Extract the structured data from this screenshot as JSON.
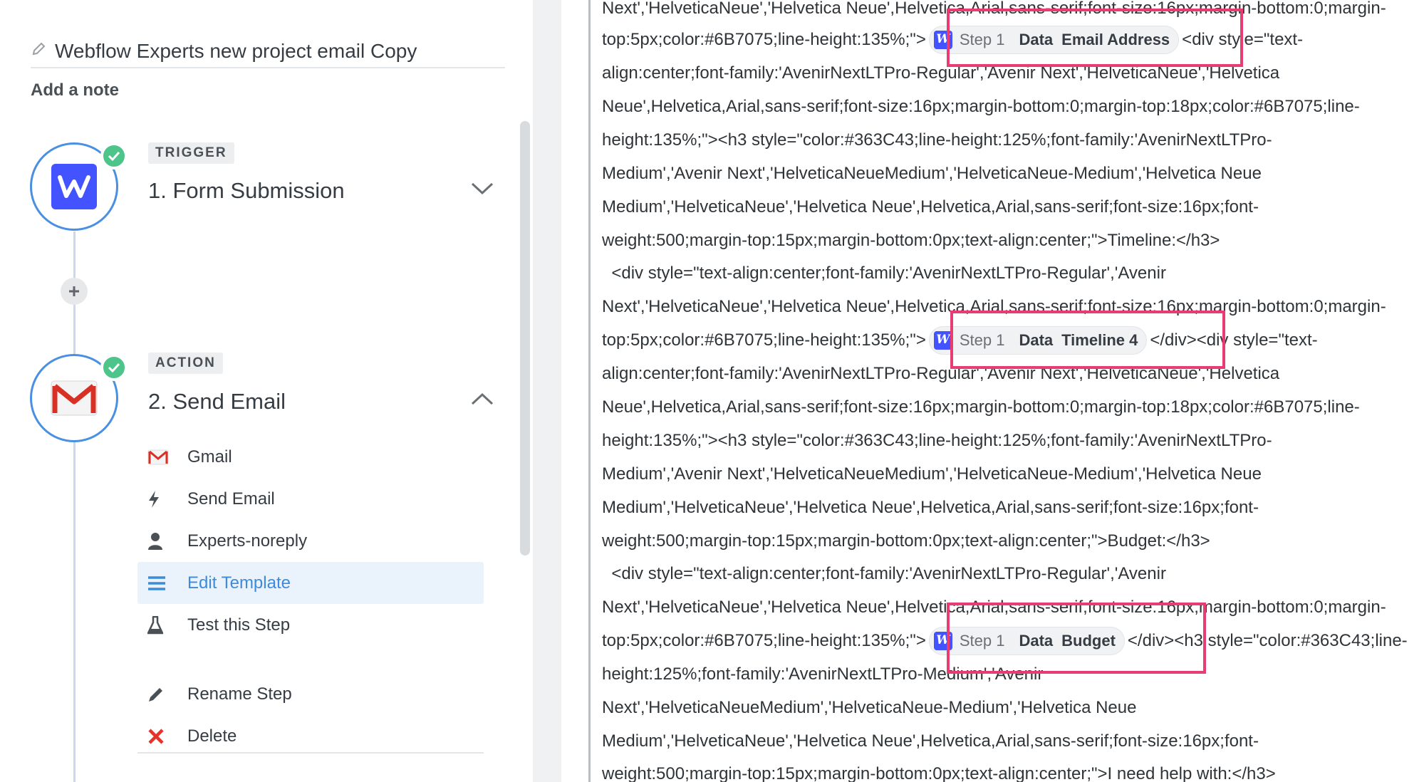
{
  "zap": {
    "title": "Webflow Experts new project email Copy",
    "note_label": "Add a note"
  },
  "steps": [
    {
      "badge": "TRIGGER",
      "title": "1. Form Submission",
      "app_icon": "webflow-logo-icon",
      "status": "complete"
    },
    {
      "badge": "ACTION",
      "title": "2. Send Email",
      "app_icon": "gmail-logo-icon",
      "status": "complete"
    }
  ],
  "menu": [
    {
      "label": "Gmail",
      "icon": "gmail-icon"
    },
    {
      "label": "Send Email",
      "icon": "bolt-icon"
    },
    {
      "label": "Experts-noreply",
      "icon": "user-icon"
    },
    {
      "label": "Edit Template",
      "icon": "list-icon",
      "active": true
    },
    {
      "label": "Test this Step",
      "icon": "flask-icon"
    },
    {
      "label": "Rename Step",
      "icon": "pencil-icon"
    },
    {
      "label": "Delete",
      "icon": "x-icon"
    }
  ],
  "pills": {
    "step_label": "Step 1",
    "data_label": "Data",
    "email": "Email Address",
    "timeline": "Timeline 4",
    "budget": "Budget"
  },
  "code": {
    "l0": "Next','HelveticaNeue','Helvetica Neue',Helvetica,Arial,sans-serif;font-size:16px;margin-bottom:0;margin-",
    "l1a": "top:5px;color:#6B7075;line-height:135%;\">",
    "l1b": "<div style=\"text-",
    "l2": "align:center;font-family:'AvenirNextLTPro-Regular','Avenir Next','HelveticaNeue','Helvetica",
    "l3": "Neue',Helvetica,Arial,sans-serif;font-size:16px;margin-bottom:0;margin-top:18px;color:#6B7075;line-",
    "l4": "height:135%;\"><h3 style=\"color:#363C43;line-height:125%;font-family:'AvenirNextLTPro-",
    "l5": "Medium','Avenir Next','HelveticaNeueMedium','HelveticaNeue-Medium','Helvetica Neue",
    "l6": "Medium','HelveticaNeue','Helvetica Neue',Helvetica,Arial,sans-serif;font-size:16px;font-",
    "l7": "weight:500;margin-top:15px;margin-bottom:0px;text-align:center;\">Timeline:</h3>",
    "l8": "  <div style=\"text-align:center;font-family:'AvenirNextLTPro-Regular','Avenir",
    "l9": "Next','HelveticaNeue','Helvetica Neue',Helvetica,Arial,sans-serif;font-size:16px;margin-bottom:0;margin-",
    "l10a": "top:5px;color:#6B7075;line-height:135%;\">",
    "l10b": "</div><div style=\"text-",
    "l11": "align:center;font-family:'AvenirNextLTPro-Regular','Avenir Next','HelveticaNeue','Helvetica",
    "l12": "Neue',Helvetica,Arial,sans-serif;font-size:16px;margin-bottom:0;margin-top:18px;color:#6B7075;line-",
    "l13": "height:135%;\"><h3 style=\"color:#363C43;line-height:125%;font-family:'AvenirNextLTPro-",
    "l14": "Medium','Avenir Next','HelveticaNeueMedium','HelveticaNeue-Medium','Helvetica Neue",
    "l15": "Medium','HelveticaNeue','Helvetica Neue',Helvetica,Arial,sans-serif;font-size:16px;font-",
    "l16": "weight:500;margin-top:15px;margin-bottom:0px;text-align:center;\">Budget:</h3>",
    "l17": "  <div style=\"text-align:center;font-family:'AvenirNextLTPro-Regular','Avenir",
    "l18": "Next','HelveticaNeue','Helvetica Neue',Helvetica,Arial,sans-serif;font-size:16px;margin-bottom:0;margin-",
    "l19a": "top:5px;color:#6B7075;line-height:135%;\">",
    "l19b": "</div><h3 style=\"color:#363C43;line-",
    "l20": "height:125%;font-family:'AvenirNextLTPro-Medium','Avenir",
    "l21": "Next','HelveticaNeueMedium','HelveticaNeue-Medium','Helvetica Neue",
    "l22": "Medium','HelveticaNeue','Helvetica Neue',Helvetica,Arial,sans-serif;font-size:16px;font-",
    "l23": "weight:500;margin-top:15px;margin-bottom:0px;text-align:center;\">I need help with:</h3>"
  },
  "colors": {
    "accent": "#4a90e2",
    "highlight": "#e83c73",
    "success": "#4cc48a",
    "webflow": "#4353ff",
    "delete": "#e5332a"
  }
}
